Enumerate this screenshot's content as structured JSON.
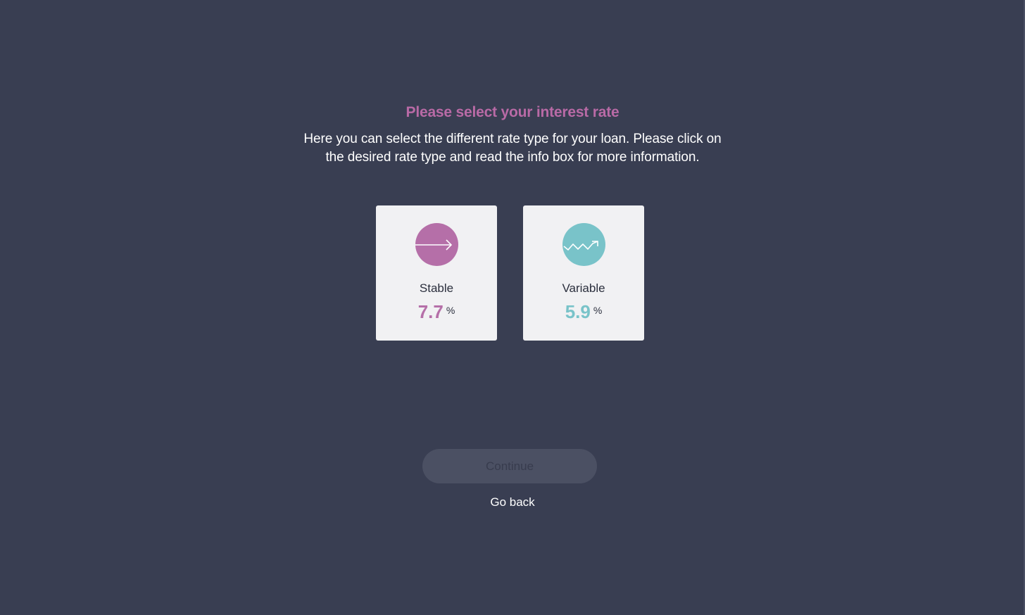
{
  "header": {
    "title": "Please select your interest rate",
    "description": "Here you can select the different rate type for your loan. Please click on the desired rate type and read the info box for more information."
  },
  "options": [
    {
      "label": "Stable",
      "rate": "7.7",
      "unit": "%",
      "icon": "arrow-right-icon",
      "color": "#b56fa8"
    },
    {
      "label": "Variable",
      "rate": "5.9",
      "unit": "%",
      "icon": "zigzag-trend-icon",
      "color": "#79c3c9"
    }
  ],
  "actions": {
    "continue_label": "Continue",
    "back_label": "Go back"
  },
  "colors": {
    "background": "#393e52",
    "accent_title": "#b96aa6",
    "card_background": "#f1f1f3",
    "button_disabled": "#4b5063"
  }
}
